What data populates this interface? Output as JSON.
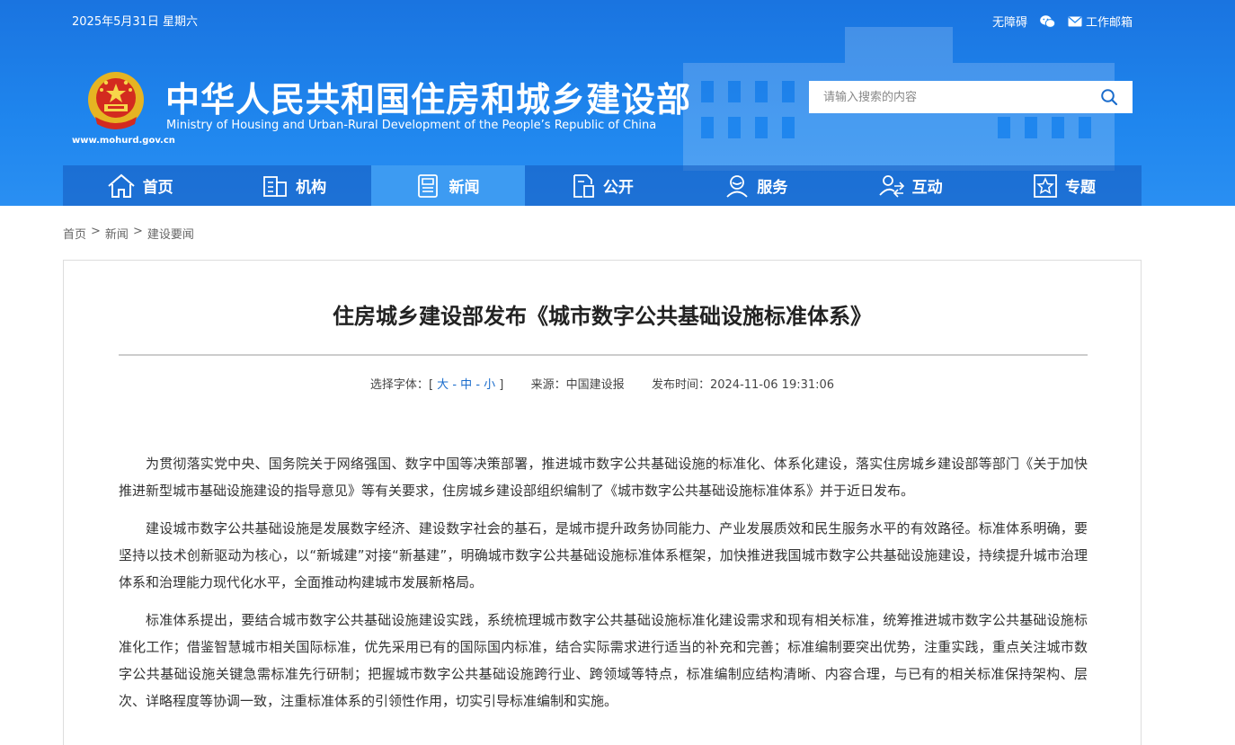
{
  "header": {
    "date": "2025年5月31日 星期六",
    "links": {
      "accessibility": "无障碍",
      "email": "工作邮箱"
    },
    "site_url": "www.mohurd.gov.cn",
    "title_cn": "中华人民共和国住房和城乡建设部",
    "title_en": "Ministry of Housing and Urban-Rural Development of the People’s Republic of China",
    "search_placeholder": "请输入搜索的内容"
  },
  "nav": [
    {
      "label": "首页",
      "icon": "home-icon"
    },
    {
      "label": "机构",
      "icon": "building-icon"
    },
    {
      "label": "新闻",
      "icon": "news-icon",
      "active": true
    },
    {
      "label": "公开",
      "icon": "document-icon"
    },
    {
      "label": "服务",
      "icon": "service-icon"
    },
    {
      "label": "互动",
      "icon": "interaction-icon"
    },
    {
      "label": "专题",
      "icon": "star-icon"
    }
  ],
  "breadcrumb": [
    "首页",
    "新闻",
    "建设要闻"
  ],
  "article": {
    "title": "住房城乡建设部发布《城市数字公共基础设施标准体系》",
    "font_label": "选择字体：",
    "font_sizes": [
      "大",
      "中",
      "小"
    ],
    "source_label": "来源：",
    "source": "中国建设报",
    "time_label": "发布时间：",
    "time": "2024-11-06 19:31:06",
    "paragraphs": [
      "为贯彻落实党中央、国务院关于网络强国、数字中国等决策部署，推进城市数字公共基础设施的标准化、体系化建设，落实住房城乡建设部等部门《关于加快推进新型城市基础设施建设的指导意见》等有关要求，住房城乡建设部组织编制了《城市数字公共基础设施标准体系》并于近日发布。",
      "建设城市数字公共基础设施是发展数字经济、建设数字社会的基石，是城市提升政务协同能力、产业发展质效和民生服务水平的有效路径。标准体系明确，要坚持以技术创新驱动为核心，以“新城建”对接“新基建”，明确城市数字公共基础设施标准体系框架，加快推进我国城市数字公共基础设施建设，持续提升城市治理体系和治理能力现代化水平，全面推动构建城市发展新格局。",
      "标准体系提出，要结合城市数字公共基础设施建设实践，系统梳理城市数字公共基础设施标准化建设需求和现有相关标准，统筹推进城市数字公共基础设施标准化工作；借鉴智慧城市相关国际标准，优先采用已有的国际国内标准，结合实际需求进行适当的补充和完善；标准编制要突出优势，注重实践，重点关注城市数字公共基础设施关键急需标准先行研制；把握城市数字公共基础设施跨行业、跨领域等特点，标准编制应结构清晰、内容合理，与已有的相关标准保持架构、层次、详略程度等协调一致，注重标准体系的引领性作用，切实引导标准编制和实施。"
    ]
  },
  "colors": {
    "header_blue": "#1f86ee",
    "nav_active": "#3d9bf2",
    "link_blue": "#1a6ccc"
  }
}
